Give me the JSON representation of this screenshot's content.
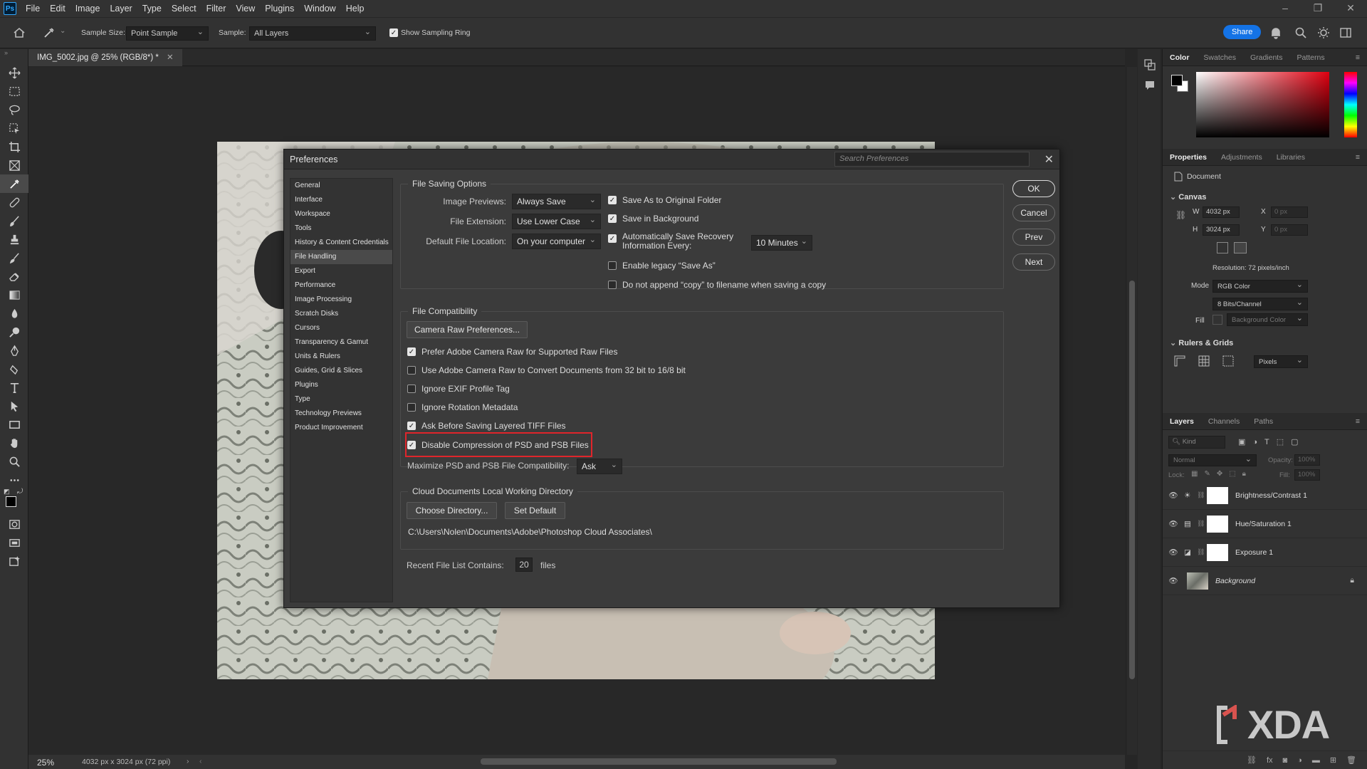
{
  "app": {
    "logo": "Ps"
  },
  "menu": [
    "File",
    "Edit",
    "Image",
    "Layer",
    "Type",
    "Select",
    "Filter",
    "View",
    "Plugins",
    "Window",
    "Help"
  ],
  "options": {
    "sample_size_label": "Sample Size:",
    "sample_size_value": "Point Sample",
    "sample_label": "Sample:",
    "sample_value": "All Layers",
    "show_ring_label": "Show Sampling Ring",
    "share_label": "Share"
  },
  "document": {
    "tab_title": "IMG_5002.jpg @ 25% (RGB/8*) *"
  },
  "status": {
    "zoom": "25%",
    "doc_info": "4032 px x 3024 px (72 ppi)"
  },
  "dialog": {
    "title": "Preferences",
    "search_placeholder": "Search Preferences",
    "nav": [
      "General",
      "Interface",
      "Workspace",
      "Tools",
      "History & Content Credentials",
      "File Handling",
      "Export",
      "Performance",
      "Image Processing",
      "Scratch Disks",
      "Cursors",
      "Transparency & Gamut",
      "Units & Rulers",
      "Guides, Grid & Slices",
      "Plugins",
      "Type",
      "Technology Previews",
      "Product Improvement"
    ],
    "nav_active": "File Handling",
    "buttons": {
      "ok": "OK",
      "cancel": "Cancel",
      "prev": "Prev",
      "next": "Next"
    },
    "file_saving": {
      "legend": "File Saving Options",
      "image_previews_label": "Image Previews:",
      "image_previews_value": "Always Save",
      "file_extension_label": "File Extension:",
      "file_extension_value": "Use Lower Case",
      "default_location_label": "Default File Location:",
      "default_location_value": "On your computer",
      "save_original_folder": "Save As to Original Folder",
      "save_background": "Save in Background",
      "auto_save_line1": "Automatically Save Recovery",
      "auto_save_line2": "Information Every:",
      "auto_save_interval": "10 Minutes",
      "legacy_save_as": "Enable legacy “Save As”",
      "no_copy_append": "Do not append “copy” to filename when saving a copy"
    },
    "file_compat": {
      "legend": "File Compatibility",
      "camera_raw_button": "Camera Raw Preferences...",
      "prefer_acr": "Prefer Adobe Camera Raw for Supported Raw Files",
      "use_acr_convert": "Use Adobe Camera Raw to Convert Documents from 32 bit to 16/8 bit",
      "ignore_exif": "Ignore EXIF Profile Tag",
      "ignore_rotation": "Ignore Rotation Metadata",
      "ask_tiff": "Ask Before Saving Layered TIFF Files",
      "disable_compression": "Disable Compression of PSD and PSB Files",
      "maximize_label": "Maximize PSD and PSB File Compatibility:",
      "maximize_value": "Ask"
    },
    "cloud": {
      "legend": "Cloud Documents Local Working Directory",
      "choose_button": "Choose Directory...",
      "default_button": "Set Default",
      "path": "C:\\Users\\Nolen\\Documents\\Adobe\\Photoshop Cloud Associates\\"
    },
    "recent": {
      "label": "Recent File List Contains:",
      "value": "20",
      "suffix": "files"
    }
  },
  "panels": {
    "color_tabs": [
      "Color",
      "Swatches",
      "Gradients",
      "Patterns"
    ],
    "prop_tabs": [
      "Properties",
      "Adjustments",
      "Libraries"
    ],
    "doc_label": "Document",
    "canvas_section": "Canvas",
    "w_label": "W",
    "w_value": "4032 px",
    "h_label": "H",
    "h_value": "3024 px",
    "x_label": "X",
    "x_value": "0 px",
    "y_label": "Y",
    "y_value": "0 px",
    "resolution": "Resolution: 72 pixels/inch",
    "mode_label": "Mode",
    "mode_value": "RGB Color",
    "bits_value": "8 Bits/Channel",
    "fill_label": "Fill",
    "fill_value": "Background Color",
    "rulers_section": "Rulers & Grids",
    "units_value": "Pixels",
    "layer_tabs": [
      "Layers",
      "Channels",
      "Paths"
    ],
    "kind_label": "Kind",
    "blend_mode": "Normal",
    "opacity_label": "Opacity:",
    "opacity_value": "100%",
    "lock_label": "Lock:",
    "fill2_label": "Fill:",
    "fill2_value": "100%",
    "layers": [
      "Brightness/Contrast 1",
      "Hue/Saturation 1",
      "Exposure 1",
      "Background"
    ]
  },
  "watermark": "XDA"
}
